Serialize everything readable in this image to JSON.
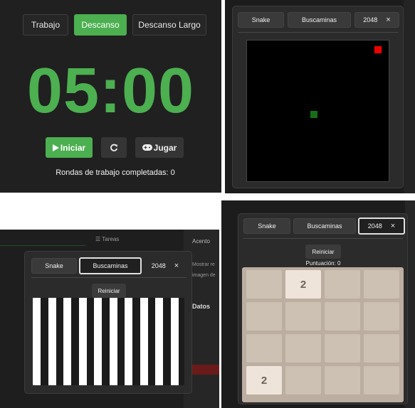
{
  "pomodoro": {
    "modes": [
      {
        "label": "Trabajo",
        "active": false
      },
      {
        "label": "Descanso",
        "active": true
      },
      {
        "label": "Descanso Largo",
        "active": false
      }
    ],
    "timer": "05:00",
    "start_label": "Iniciar",
    "reset_icon": "refresh-icon",
    "play_label": "Jugar",
    "play_icon": "gamepad-icon",
    "rounds_text": "Rondas de trabajo completadas: 0",
    "accent": "#4caf50"
  },
  "snake_window": {
    "tabs": [
      "Snake",
      "Buscaminas",
      "2048"
    ],
    "close_glyph": "×",
    "food_color": "#f00000",
    "snake_color": "#166f16"
  },
  "buscaminas_window": {
    "tabs": [
      "Snake",
      "Buscaminas",
      "2048"
    ],
    "close_glyph": "×",
    "reset_label": "Reiniciar",
    "background_fragments": {
      "tareas": "☰ Tareas",
      "acento": "Acento",
      "mostrar": "Mostrar re",
      "imagen": "imagen de",
      "datos": "Datos"
    }
  },
  "game2048_window": {
    "tabs": [
      "Snake",
      "Buscaminas",
      "2048"
    ],
    "close_glyph": "×",
    "reset_label": "Reiniciar",
    "score_text": "Puntuación: 0",
    "tiles": [
      [
        "",
        "2",
        "",
        ""
      ],
      [
        "",
        "",
        "",
        ""
      ],
      [
        "",
        "",
        "",
        ""
      ],
      [
        "2",
        "",
        "",
        ""
      ]
    ]
  }
}
